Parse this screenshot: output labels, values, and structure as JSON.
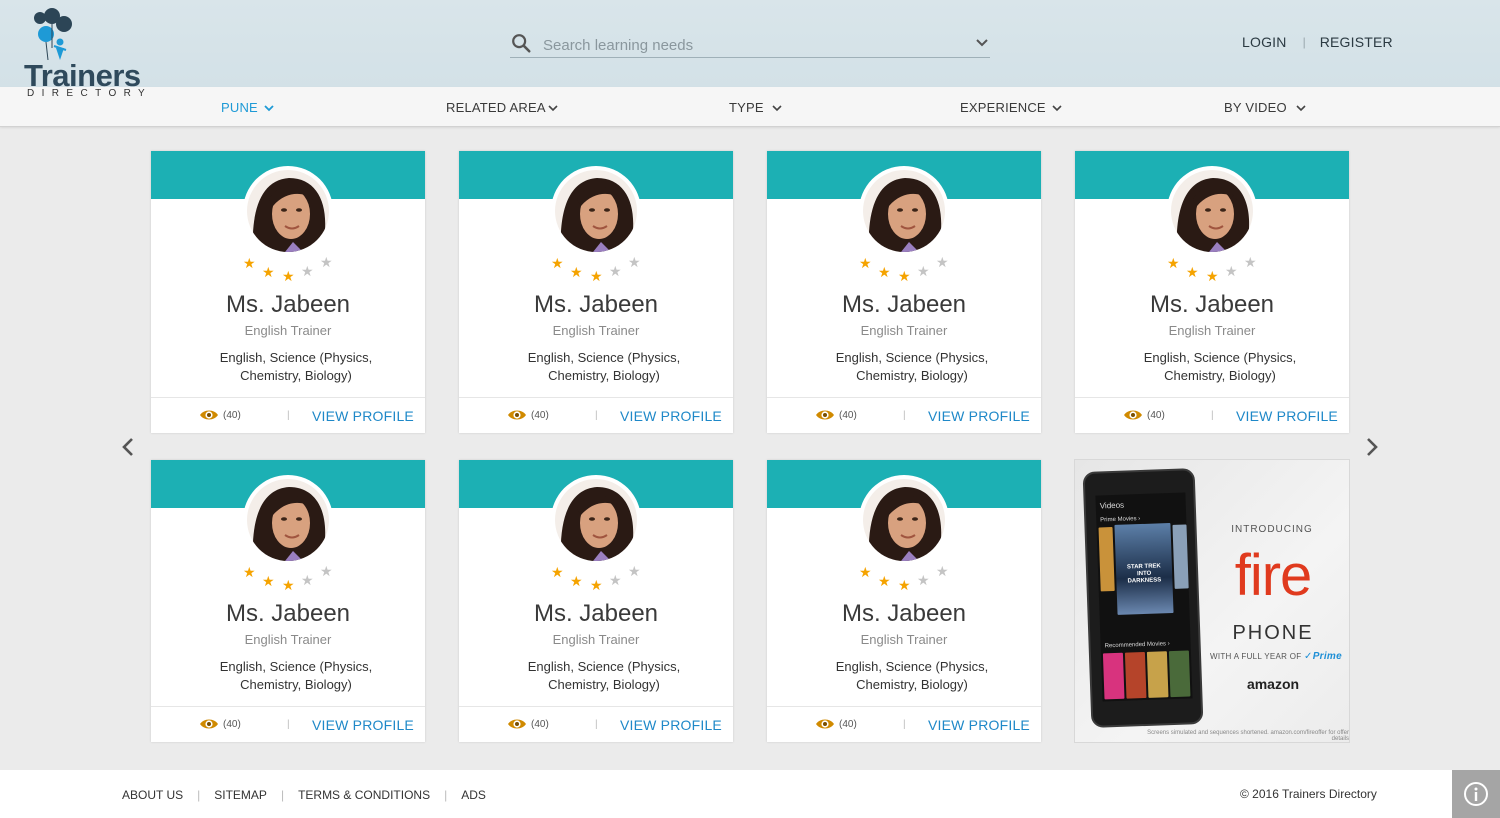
{
  "brand": {
    "logo_word": "Trainers",
    "logo_sub": "DIRECTORY"
  },
  "search": {
    "placeholder": "Search learning needs"
  },
  "auth": {
    "login": "LOGIN",
    "register": "REGISTER"
  },
  "filters": [
    {
      "label": "PUNE",
      "active": true
    },
    {
      "label": "RELATED AREA",
      "active": false
    },
    {
      "label": "TYPE",
      "active": false
    },
    {
      "label": "EXPERIENCE",
      "active": false
    },
    {
      "label": "BY VIDEO",
      "active": false
    }
  ],
  "cards": [
    {
      "name": "Ms. Jabeen",
      "role": "English Trainer",
      "subjects": "English, Science (Physics, Chemistry, Biology)",
      "rating": 3,
      "views": "(40)",
      "cta": "VIEW PROFILE"
    },
    {
      "name": "Ms. Jabeen",
      "role": "English Trainer",
      "subjects": "English, Science (Physics, Chemistry, Biology)",
      "rating": 3,
      "views": "(40)",
      "cta": "VIEW PROFILE"
    },
    {
      "name": "Ms. Jabeen",
      "role": "English Trainer",
      "subjects": "English, Science (Physics, Chemistry, Biology)",
      "rating": 3,
      "views": "(40)",
      "cta": "VIEW PROFILE"
    },
    {
      "name": "Ms. Jabeen",
      "role": "English Trainer",
      "subjects": "English, Science (Physics, Chemistry, Biology)",
      "rating": 3,
      "views": "(40)",
      "cta": "VIEW PROFILE"
    },
    {
      "name": "Ms. Jabeen",
      "role": "English Trainer",
      "subjects": "English, Science (Physics, Chemistry, Biology)",
      "rating": 3,
      "views": "(40)",
      "cta": "VIEW PROFILE"
    },
    {
      "name": "Ms. Jabeen",
      "role": "English Trainer",
      "subjects": "English, Science (Physics, Chemistry, Biology)",
      "rating": 3,
      "views": "(40)",
      "cta": "VIEW PROFILE"
    },
    {
      "name": "Ms. Jabeen",
      "role": "English Trainer",
      "subjects": "English, Science (Physics, Chemistry, Biology)",
      "rating": 3,
      "views": "(40)",
      "cta": "VIEW PROFILE"
    }
  ],
  "ad": {
    "intro": "INTRODUCING",
    "headline": "fire",
    "product": "PHONE",
    "offer": "WITH A FULL YEAR OF",
    "offer_brand": "✓Prime",
    "brand": "amazon",
    "screen_title": "Videos",
    "screen_section_1": "Prime Movies ›",
    "screen_section_2": "Recommended Movies ›",
    "poster_title": "STAR TREK INTO DARKNESS",
    "disclaimer": "Screens simulated and sequences shortened. amazon.com/fireoffer for offer details"
  },
  "footer": {
    "links": [
      "ABOUT US",
      "SITEMAP",
      "TERMS & CONDITIONS",
      "ADS"
    ],
    "copyright": "© 2016 Trainers Directory"
  },
  "colors": {
    "accent": "#1cb0b4",
    "link": "#1e88c8",
    "active_filter": "#1e9ad6",
    "star_on": "#f5a300",
    "star_off": "#c4c4c4",
    "eye": "#d08a00"
  },
  "icons": {
    "search": "search-icon",
    "dropdown": "chevron-down-icon",
    "views": "eye-icon",
    "prev": "chevron-left-icon",
    "next": "chevron-right-icon",
    "info": "info-icon"
  }
}
